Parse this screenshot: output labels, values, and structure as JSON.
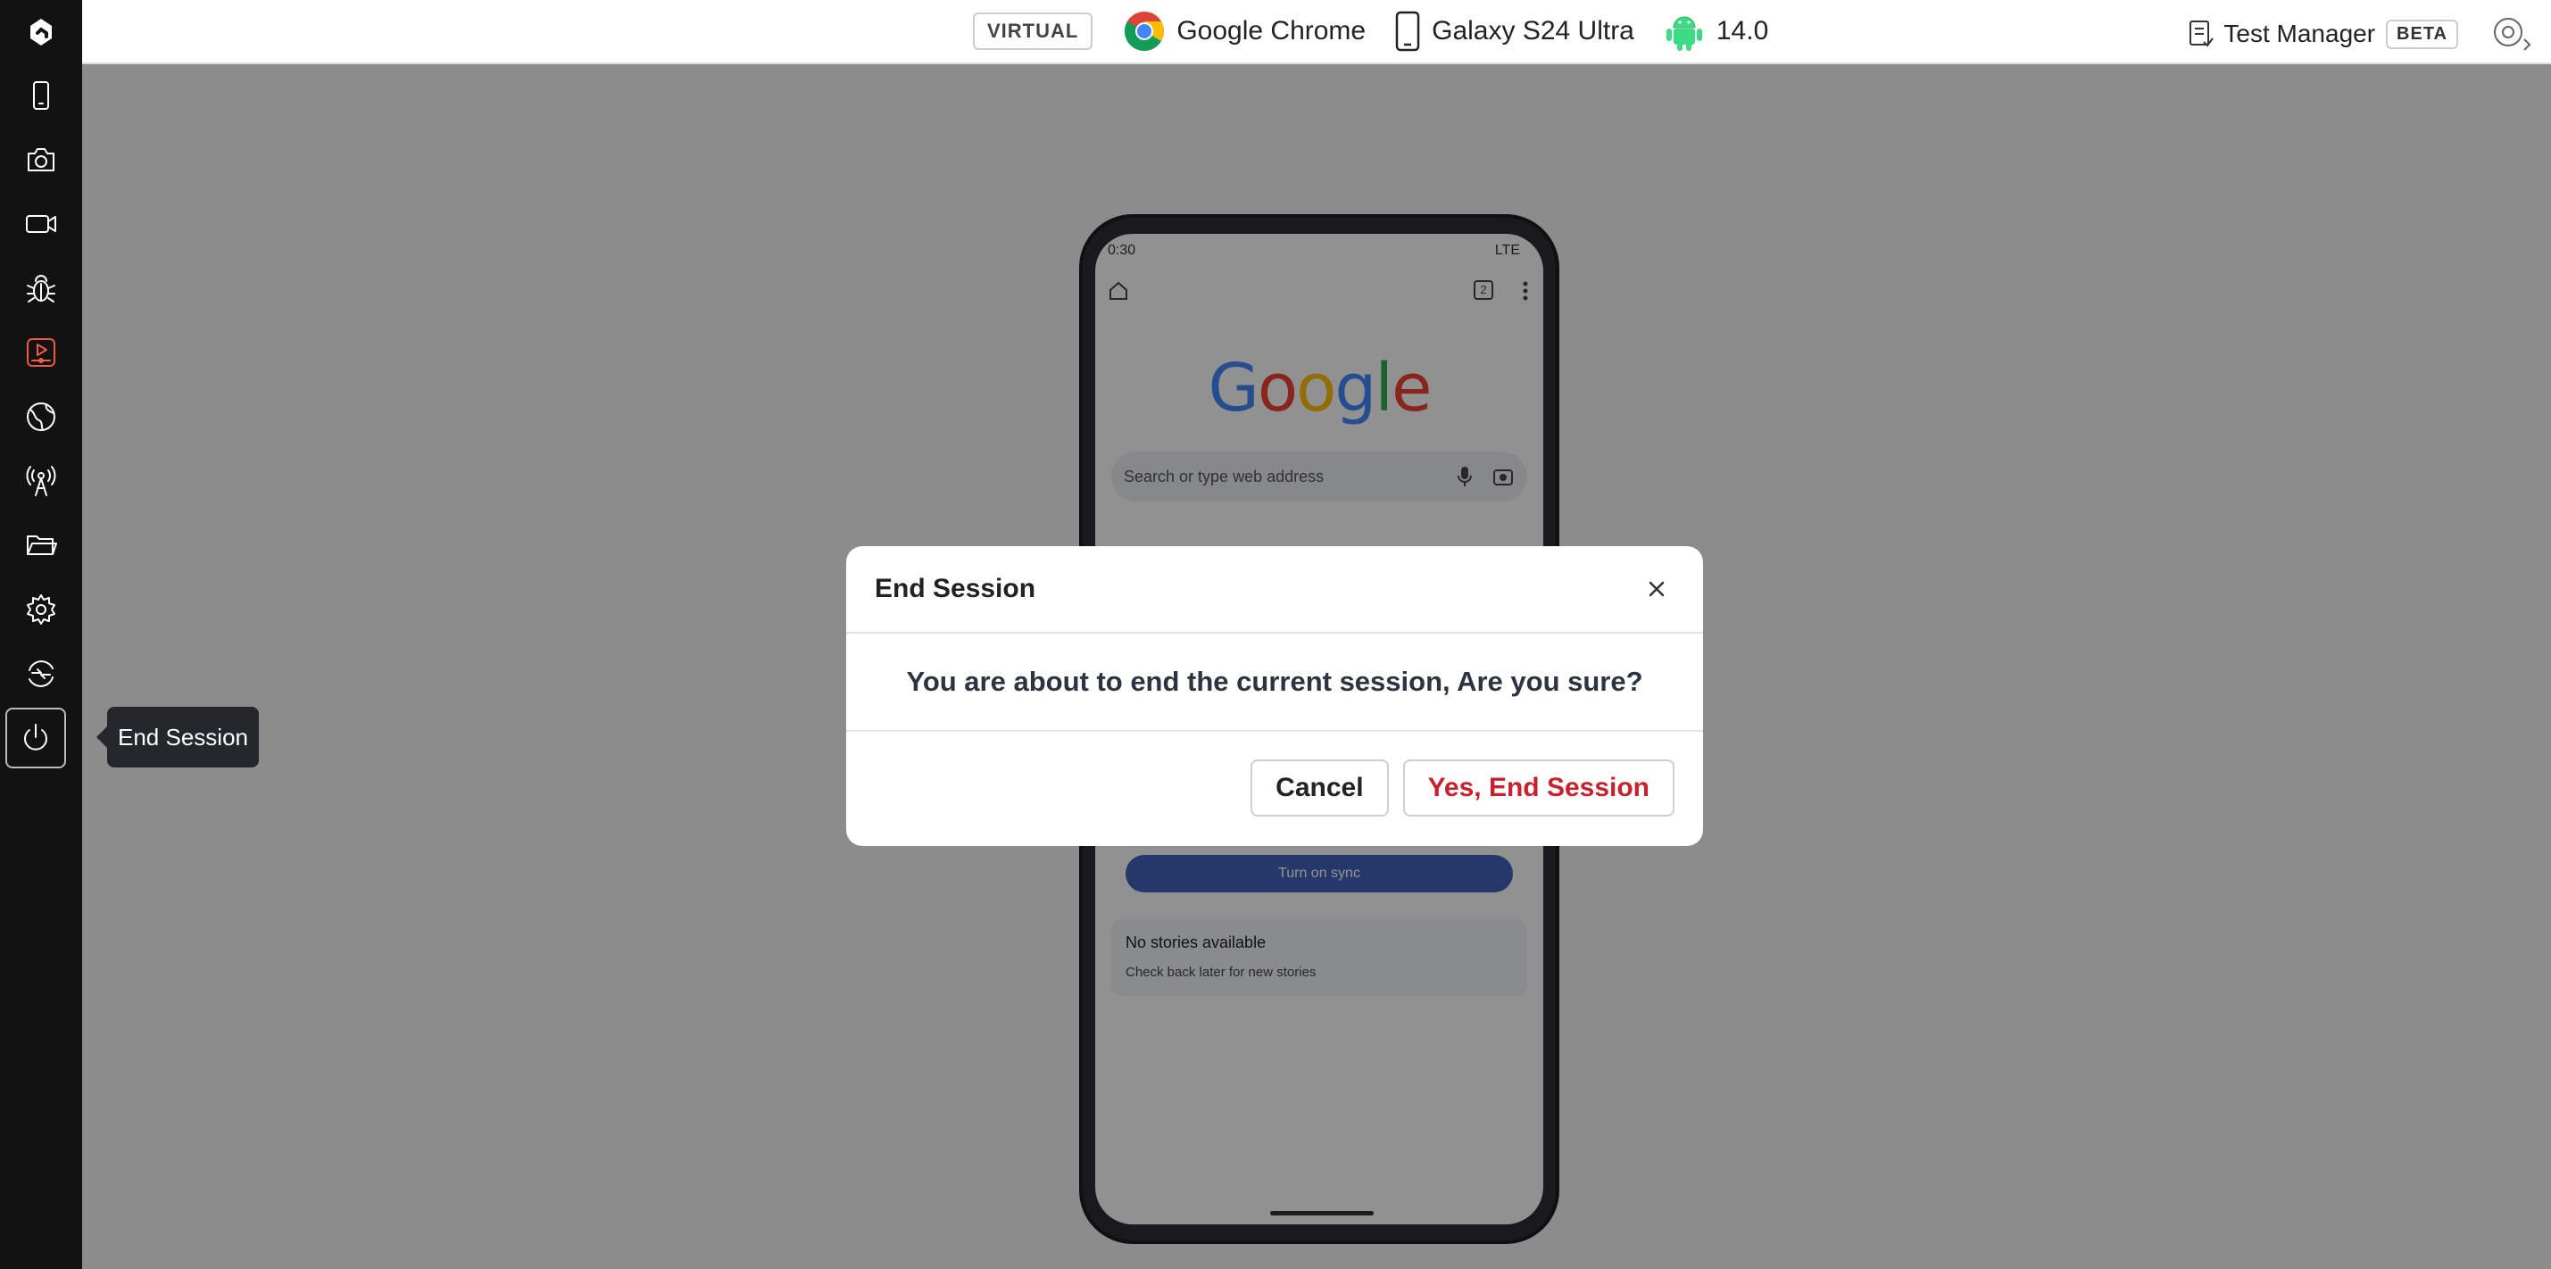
{
  "topbar": {
    "virtual_badge": "VIRTUAL",
    "browser": "Google Chrome",
    "device": "Galaxy S24 Ultra",
    "os_version": "14.0",
    "test_manager": "Test Manager",
    "beta_badge": "BETA"
  },
  "sidebar": {
    "items": [
      {
        "icon": "logo-icon"
      },
      {
        "icon": "device-icon"
      },
      {
        "icon": "camera-icon"
      },
      {
        "icon": "video-icon"
      },
      {
        "icon": "bug-icon"
      },
      {
        "icon": "screen-record-icon",
        "active": true
      },
      {
        "icon": "globe-icon"
      },
      {
        "icon": "network-tower-icon"
      },
      {
        "icon": "folder-icon"
      },
      {
        "icon": "settings-icon"
      },
      {
        "icon": "switch-icon"
      },
      {
        "icon": "power-icon",
        "selected": true
      }
    ]
  },
  "tooltip": {
    "label": "End Session"
  },
  "phone": {
    "status_time": "0:30",
    "status_network": "LTE",
    "tab_count": "2",
    "search_placeholder": "Search or type web address",
    "sync_button": "Turn on sync",
    "stories_title": "No stories available",
    "stories_sub": "Check back later for new stories"
  },
  "dialog": {
    "title": "End Session",
    "message": "You are about to end the current session, Are you sure?",
    "cancel_label": "Cancel",
    "confirm_label": "Yes, End Session"
  },
  "colors": {
    "sidebar_bg": "#121212",
    "accent_red": "#c7212e",
    "active_icon": "#ef5b4b",
    "sync_blue": "#3f63b5"
  }
}
